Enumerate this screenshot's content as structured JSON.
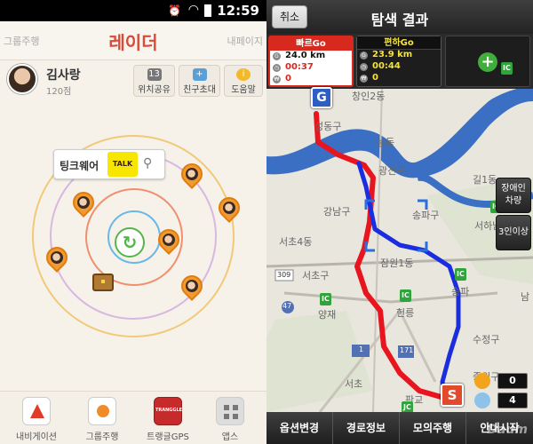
{
  "status_bar": {
    "time": "12:59"
  },
  "left_app": {
    "header": {
      "prev_tab": "그룹주행",
      "title": "레이더",
      "next_tab": "내페이지"
    },
    "profile": {
      "name": "김사랑",
      "points": "120점"
    },
    "buttons": {
      "share": {
        "badge": "13",
        "label": "위치공유"
      },
      "invite": {
        "label": "친구초대"
      },
      "help": {
        "label": "도움말"
      }
    },
    "bubble": {
      "label": "팅크웨어",
      "talk": "TALK"
    },
    "bottom_nav": [
      {
        "label": "내비게이션",
        "icon": "navigation-icon"
      },
      {
        "label": "그룹주행",
        "icon": "group-drive-icon"
      },
      {
        "label": "트랭글GPS",
        "icon": "tranggle-icon",
        "logo_text": "TRANGGLE"
      },
      {
        "label": "앱스",
        "icon": "apps-grid-icon"
      }
    ],
    "colors": {
      "title": "#d94a38",
      "ring_outer": "#f1c978",
      "ring_mid": "#d8b8e0",
      "ring_inner": "#f08f6e",
      "ring_core": "#6ab8e8"
    }
  },
  "right_app": {
    "header": {
      "cancel": "취소",
      "title": "탐색 결과"
    },
    "routes": [
      {
        "name": "빠르Go",
        "distance": "24.0 km",
        "time": "00:37",
        "toll": "0"
      },
      {
        "name": "편하Go",
        "distance": "23.9 km",
        "time": "00:44",
        "toll": "0"
      }
    ],
    "side_buttons": {
      "disabled": "장애인 차량",
      "three_plus": "3인이상"
    },
    "map_labels": [
      "창인2동",
      "성동구",
      "능동",
      "광진구",
      "길1동",
      "강남구",
      "송파구",
      "서하남",
      "서초4동",
      "잠원1동",
      "서초구",
      "송파",
      "헌릉",
      "양재",
      "수정구",
      "중원구",
      "판교",
      "서초",
      "남"
    ],
    "markers": {
      "goal": "G",
      "start": "S"
    },
    "road_numbers": [
      "309",
      "47",
      "1",
      "171"
    ],
    "counters": {
      "top": "0",
      "bottom": "4"
    },
    "bottom_bar": [
      "옵션변경",
      "경로정보",
      "모의주행",
      "안내시작"
    ],
    "watermark": "Daum",
    "colors": {
      "fast_route": "#e8151e",
      "easy_route": "#1a2ee0",
      "river": "#3b6fc4"
    }
  }
}
